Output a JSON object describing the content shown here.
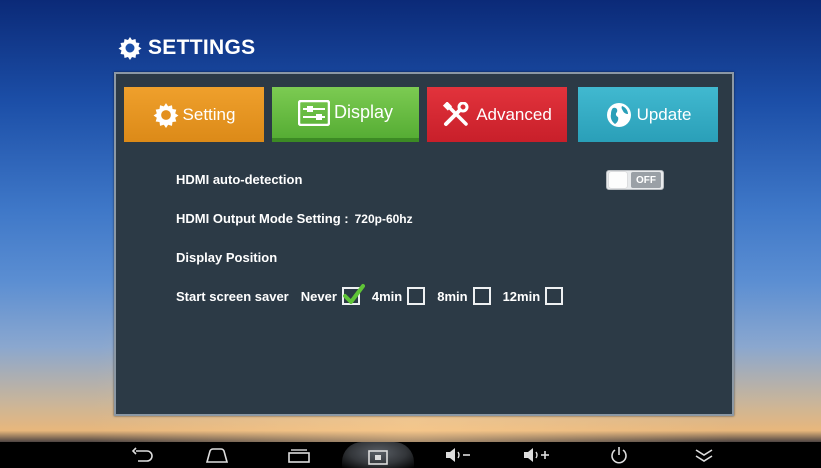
{
  "title": "SETTINGS",
  "tabs": [
    {
      "label": "Setting",
      "icon": "gear-icon",
      "color": "#e8962a"
    },
    {
      "label": "Display",
      "icon": "display-sliders-icon",
      "color": "#6cbd44"
    },
    {
      "label": "Advanced",
      "icon": "tools-icon",
      "color": "#d82a34"
    },
    {
      "label": "Update",
      "icon": "globe-icon",
      "color": "#36adc6"
    }
  ],
  "hdmi_auto_detection": {
    "label": "HDMI auto-detection",
    "toggle_state": "OFF"
  },
  "hdmi_output": {
    "label": "HDMI Output Mode Setting :",
    "value": "720p-60hz"
  },
  "display_position": {
    "label": "Display Position"
  },
  "screen_saver": {
    "label": "Start screen saver",
    "options": [
      {
        "label": "Never",
        "checked": true
      },
      {
        "label": "4min",
        "checked": false
      },
      {
        "label": "8min",
        "checked": false
      },
      {
        "label": "12min",
        "checked": false
      }
    ]
  },
  "navbar": {
    "buttons": [
      "back-icon",
      "home-icon",
      "recents-icon",
      "screenshot-icon",
      "volume-down-icon",
      "volume-up-icon",
      "power-icon",
      "hide-bar-icon"
    ]
  }
}
